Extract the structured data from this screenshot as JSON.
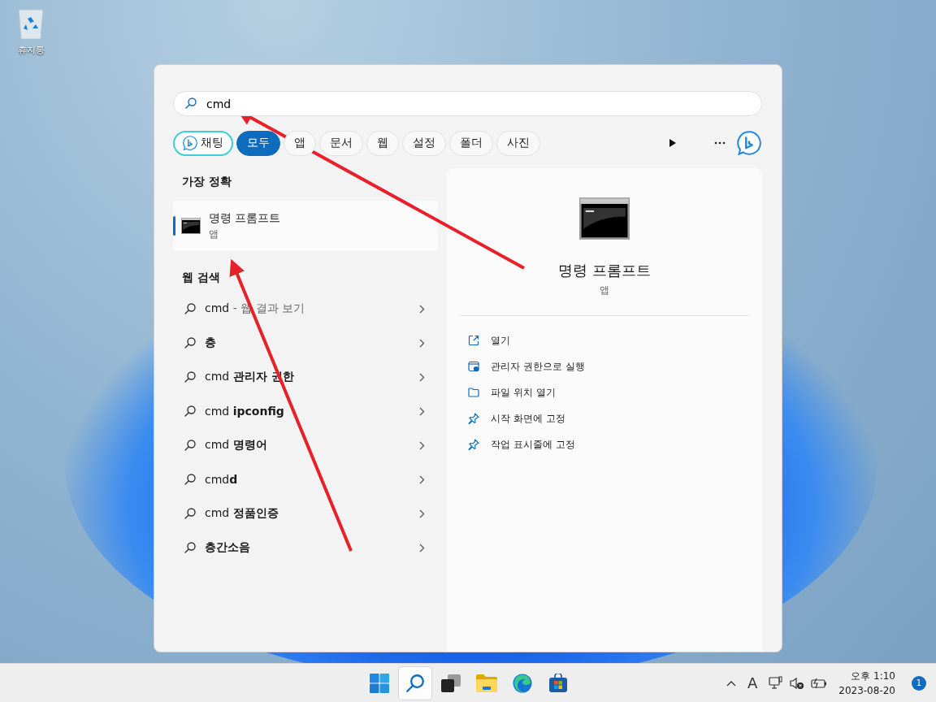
{
  "desktop": {
    "icons": [
      {
        "label": "휴지통"
      }
    ]
  },
  "search": {
    "value": "cmd"
  },
  "filters": [
    {
      "label": "채팅",
      "kind": "chat",
      "selected": false
    },
    {
      "label": "모두",
      "kind": "chip",
      "selected": true
    },
    {
      "label": "앱",
      "kind": "chip",
      "selected": false
    },
    {
      "label": "문서",
      "kind": "chip",
      "selected": false
    },
    {
      "label": "웹",
      "kind": "chip",
      "selected": false
    },
    {
      "label": "설정",
      "kind": "chip",
      "selected": false
    },
    {
      "label": "폴더",
      "kind": "chip",
      "selected": false
    },
    {
      "label": "사진",
      "kind": "chip",
      "selected": false
    }
  ],
  "best_match": {
    "heading": "가장 정확",
    "title": "명령 프롬프트",
    "subtitle": "앱",
    "selected": true
  },
  "web_search": {
    "heading": "웹 검색",
    "items": [
      {
        "text": "cmd",
        "hint": "- 웹 결과 보기"
      },
      {
        "text": "**층**"
      },
      {
        "text": "cmd **관리자 권한**"
      },
      {
        "text": "cmd **ipconfig**"
      },
      {
        "text": "cmd **명령어**"
      },
      {
        "text": "cmd**d**"
      },
      {
        "text": "cmd **정품인증**"
      },
      {
        "text": "**층간소음**"
      }
    ]
  },
  "preview": {
    "title": "명령 프롬프트",
    "subtitle": "앱",
    "actions": [
      {
        "label": "열기",
        "kind": "open"
      },
      {
        "label": "관리자 권한으로 실행",
        "kind": "admin"
      },
      {
        "label": "파일 위치 열기",
        "kind": "folder"
      },
      {
        "label": "시작 화면에 고정",
        "kind": "pin"
      },
      {
        "label": "작업 표시줄에 고정",
        "kind": "pin"
      }
    ]
  },
  "taskbar": {
    "apps": [
      {
        "kind": "start",
        "selected": false
      },
      {
        "kind": "search",
        "selected": true
      },
      {
        "kind": "taskview",
        "selected": false
      },
      {
        "kind": "explorer",
        "selected": false
      },
      {
        "kind": "edge",
        "selected": false
      },
      {
        "kind": "store",
        "selected": false
      }
    ],
    "tray": {
      "ime": "A",
      "time": "오후 1:10",
      "date": "2023-08-20",
      "notifications": "1"
    }
  }
}
